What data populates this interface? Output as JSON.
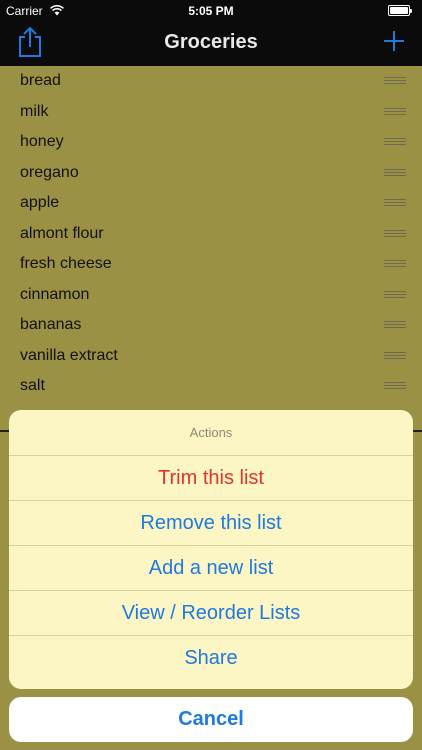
{
  "status_bar": {
    "carrier": "Carrier",
    "time": "5:05 PM"
  },
  "nav": {
    "title": "Groceries",
    "left_icon": "share-icon",
    "right_icon": "plus-icon",
    "accent": "#1e7ae0"
  },
  "items": [
    {
      "label": "bread"
    },
    {
      "label": "milk"
    },
    {
      "label": "honey"
    },
    {
      "label": "oregano"
    },
    {
      "label": "apple"
    },
    {
      "label": "almont flour"
    },
    {
      "label": "fresh cheese"
    },
    {
      "label": "cinnamon"
    },
    {
      "label": "bananas"
    },
    {
      "label": "vanilla extract"
    },
    {
      "label": "salt"
    }
  ],
  "action_sheet": {
    "title": "Actions",
    "actions": [
      {
        "label": "Trim this list",
        "style": "destructive",
        "color": "#e0352b"
      },
      {
        "label": "Remove this list"
      },
      {
        "label": "Add a new list"
      },
      {
        "label": "View / Reorder Lists"
      },
      {
        "label": "Share"
      }
    ],
    "cancel_label": "Cancel"
  }
}
